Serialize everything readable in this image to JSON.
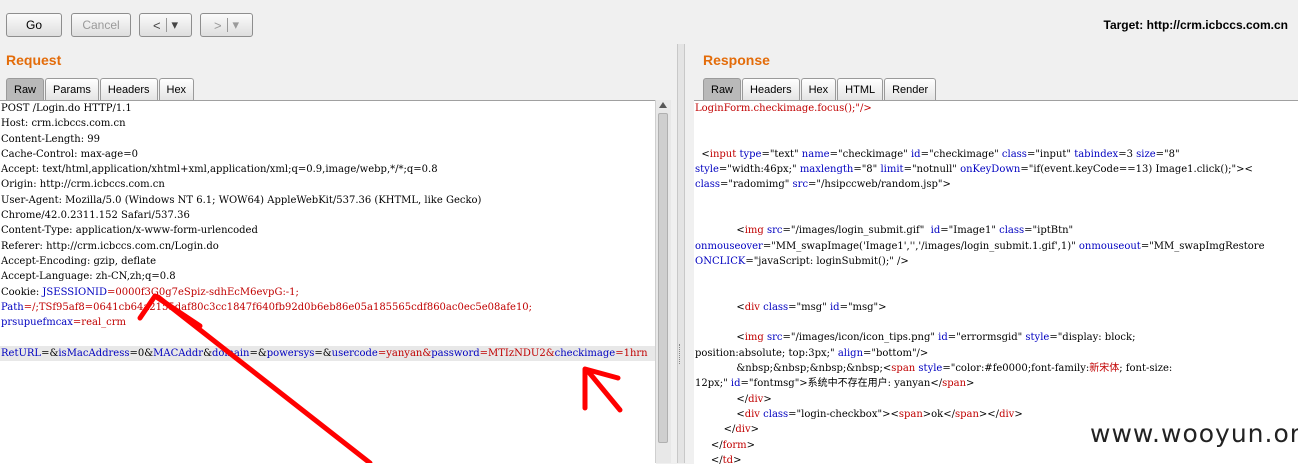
{
  "toolbar": {
    "go_label": "Go",
    "cancel_label": "Cancel",
    "back_label": "<",
    "back_menu": "▾",
    "forward_label": ">",
    "forward_menu": "▾",
    "target_label": "Target: http://crm.icbccs.com.cn"
  },
  "request": {
    "title": "Request",
    "tabs": [
      "Raw",
      "Params",
      "Headers",
      "Hex"
    ],
    "lines": [
      "POST /Login.do HTTP/1.1",
      "Host: crm.icbccs.com.cn",
      "Content-Length: 99",
      "Cache-Control: max-age=0",
      "Accept: text/html,application/xhtml+xml,application/xml;q=0.9,image/webp,*/*;q=0.8",
      "Origin: http://crm.icbccs.com.cn",
      "User-Agent: Mozilla/5.0 (Windows NT 6.1; WOW64) AppleWebKit/537.36 (KHTML, like Gecko)",
      "Chrome/42.0.2311.152 Safari/537.36",
      "Content-Type: application/x-www-form-urlencoded",
      "Referer: http://crm.icbccs.com.cn/Login.do",
      "Accept-Encoding: gzip, deflate",
      "Accept-Language: zh-CN,zh;q=0.8"
    ],
    "cookie_label": "Cookie: ",
    "cookie_name": "JSESSIONID",
    "cookie_value": "=0000f3G0g7eSpiz-sdhEcM6evpG:-1;",
    "path_name": "Path",
    "path_value": "=/;TSf95af8=0641cb64a2155daf80c3cc1847f640fb92d0b6eb86e05a185565cdf860ac0ec5e08afe10;",
    "prsu_name": "prsupuefmcax",
    "prsu_value": "=real_crm",
    "body_parts": [
      {
        "t": "RetURL",
        "c": "blue"
      },
      {
        "t": "=&",
        "c": ""
      },
      {
        "t": "isMacAddress",
        "c": "blue"
      },
      {
        "t": "=0&",
        "c": ""
      },
      {
        "t": "MACAddr",
        "c": "blue"
      },
      {
        "t": "&",
        "c": ""
      },
      {
        "t": "domain",
        "c": "blue"
      },
      {
        "t": "=&",
        "c": ""
      },
      {
        "t": "powersys",
        "c": "blue"
      },
      {
        "t": "=&",
        "c": ""
      },
      {
        "t": "usercode",
        "c": "blue"
      },
      {
        "t": "=yanyan&",
        "c": "red"
      },
      {
        "t": "password",
        "c": "blue"
      },
      {
        "t": "=MTIzNDU2&",
        "c": "red"
      },
      {
        "t": "checkimage",
        "c": "blue"
      },
      {
        "t": "=1hrn",
        "c": "red"
      }
    ]
  },
  "response": {
    "title": "Response",
    "tabs": [
      "Raw",
      "Headers",
      "Hex",
      "HTML",
      "Render"
    ],
    "lines": [
      [
        {
          "t": "LoginForm.checkimage.focus();\"/>",
          "c": "red"
        }
      ],
      [],
      [],
      [
        {
          "t": "  <",
          "c": ""
        },
        {
          "t": "input ",
          "c": "red"
        },
        {
          "t": "type",
          "c": "blue"
        },
        {
          "t": "=\"text\" ",
          "c": ""
        },
        {
          "t": "name",
          "c": "blue"
        },
        {
          "t": "=\"checkimage\" ",
          "c": ""
        },
        {
          "t": "id",
          "c": "blue"
        },
        {
          "t": "=\"checkimage\" ",
          "c": ""
        },
        {
          "t": "class",
          "c": "blue"
        },
        {
          "t": "=\"input\" ",
          "c": ""
        },
        {
          "t": "tabindex",
          "c": "blue"
        },
        {
          "t": "=3 ",
          "c": ""
        },
        {
          "t": "size",
          "c": "blue"
        },
        {
          "t": "=\"8\"",
          "c": ""
        }
      ],
      [
        {
          "t": "style",
          "c": "blue"
        },
        {
          "t": "=\"width:46px;\" ",
          "c": ""
        },
        {
          "t": "maxlength",
          "c": "blue"
        },
        {
          "t": "=\"8\" ",
          "c": ""
        },
        {
          "t": "limit",
          "c": "blue"
        },
        {
          "t": "=\"notnull\" ",
          "c": ""
        },
        {
          "t": "onKeyDown",
          "c": "blue"
        },
        {
          "t": "=\"if(event.keyCode==13) Image1.click();\"><",
          "c": ""
        }
      ],
      [
        {
          "t": "class",
          "c": "blue"
        },
        {
          "t": "=\"radomimg\" ",
          "c": ""
        },
        {
          "t": "src",
          "c": "blue"
        },
        {
          "t": "=\"/hsipccweb/random.jsp\">",
          "c": ""
        }
      ],
      [],
      [],
      [
        {
          "t": "             <",
          "c": ""
        },
        {
          "t": "img ",
          "c": "red"
        },
        {
          "t": "src",
          "c": "blue"
        },
        {
          "t": "=\"/images/login_submit.gif\"  ",
          "c": ""
        },
        {
          "t": "id",
          "c": "blue"
        },
        {
          "t": "=\"Image1\" ",
          "c": ""
        },
        {
          "t": "class",
          "c": "blue"
        },
        {
          "t": "=\"iptBtn\"",
          "c": ""
        }
      ],
      [
        {
          "t": "onmouseover",
          "c": "blue"
        },
        {
          "t": "=\"MM_swapImage('Image1','','/images/login_submit.1.gif',1)\" ",
          "c": ""
        },
        {
          "t": "onmouseout",
          "c": "blue"
        },
        {
          "t": "=\"MM_swapImgRestore",
          "c": ""
        }
      ],
      [
        {
          "t": "ONCLICK",
          "c": "blue"
        },
        {
          "t": "=\"javaScript: loginSubmit();\" />",
          "c": ""
        }
      ],
      [],
      [],
      [
        {
          "t": "             <",
          "c": ""
        },
        {
          "t": "div ",
          "c": "red"
        },
        {
          "t": "class",
          "c": "blue"
        },
        {
          "t": "=\"msg\" ",
          "c": ""
        },
        {
          "t": "id",
          "c": "blue"
        },
        {
          "t": "=\"msg\">",
          "c": ""
        }
      ],
      [],
      [
        {
          "t": "             <",
          "c": ""
        },
        {
          "t": "img ",
          "c": "red"
        },
        {
          "t": "src",
          "c": "blue"
        },
        {
          "t": "=\"/images/icon/icon_tips.png\" ",
          "c": ""
        },
        {
          "t": "id",
          "c": "blue"
        },
        {
          "t": "=\"errormsgid\" ",
          "c": ""
        },
        {
          "t": "style",
          "c": "blue"
        },
        {
          "t": "=\"display: block;",
          "c": ""
        }
      ],
      [
        {
          "t": "position:absolute; top:3px;\" ",
          "c": ""
        },
        {
          "t": "align",
          "c": "blue"
        },
        {
          "t": "=\"bottom\"/>",
          "c": ""
        }
      ],
      [
        {
          "t": "             &nbsp;&nbsp;&nbsp;&nbsp;<",
          "c": ""
        },
        {
          "t": "span ",
          "c": "red"
        },
        {
          "t": "style",
          "c": "blue"
        },
        {
          "t": "=\"color:#fe0000;font-family:",
          "c": ""
        },
        {
          "t": "新宋体",
          "c": "red"
        },
        {
          "t": "; font-size:",
          "c": ""
        }
      ],
      [
        {
          "t": "12px;\" ",
          "c": ""
        },
        {
          "t": "id",
          "c": "blue"
        },
        {
          "t": "=\"fontmsg\">系统中不存在用户: yanyan</",
          "c": ""
        },
        {
          "t": "span",
          "c": "red"
        },
        {
          "t": ">",
          "c": ""
        }
      ],
      [
        {
          "t": "             </",
          "c": ""
        },
        {
          "t": "div",
          "c": "red"
        },
        {
          "t": ">",
          "c": ""
        }
      ],
      [
        {
          "t": "             <",
          "c": ""
        },
        {
          "t": "div ",
          "c": "red"
        },
        {
          "t": "class",
          "c": "blue"
        },
        {
          "t": "=\"login-checkbox\"><",
          "c": ""
        },
        {
          "t": "span",
          "c": "red"
        },
        {
          "t": ">ok</",
          "c": ""
        },
        {
          "t": "span",
          "c": "red"
        },
        {
          "t": "></",
          "c": ""
        },
        {
          "t": "div",
          "c": "red"
        },
        {
          "t": ">",
          "c": ""
        }
      ],
      [
        {
          "t": "         </",
          "c": ""
        },
        {
          "t": "div",
          "c": "red"
        },
        {
          "t": ">",
          "c": ""
        }
      ],
      [
        {
          "t": "     </",
          "c": ""
        },
        {
          "t": "form",
          "c": "red"
        },
        {
          "t": ">",
          "c": ""
        }
      ],
      [
        {
          "t": "     </",
          "c": ""
        },
        {
          "t": "td",
          "c": "red"
        },
        {
          "t": ">",
          "c": ""
        }
      ]
    ]
  },
  "watermark": "www.wooyun.org",
  "colors": {
    "title_orange": "#e36c0a",
    "arrow_red": "#ff0000",
    "key_blue": "#0000c0",
    "value_red": "#c00000"
  }
}
